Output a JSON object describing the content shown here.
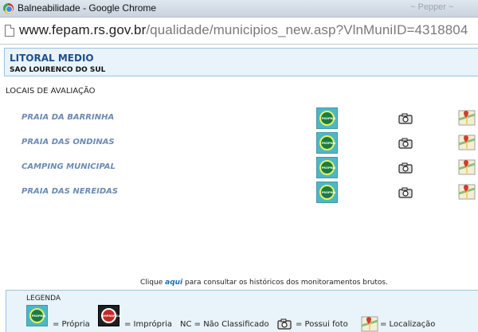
{
  "window": {
    "title": "Balneabilidade - Google Chrome",
    "faded_text": "~ Pepper ~"
  },
  "addressbar": {
    "host": "www.fepam.rs.gov.br",
    "path": "/qualidade/municipios_new.asp?VlnMuniID=4318804"
  },
  "header": {
    "region": "LITORAL MEDIO",
    "city": "SAO LOURENCO DO SUL"
  },
  "section_title": "LOCAIS DE AVALIAÇÃO",
  "badge_labels": {
    "propria": "PRÓPRIA",
    "impropria": "IMPRÓPRIA"
  },
  "beaches": [
    {
      "name": "PRAIA DA BARRINHA",
      "status": "propria"
    },
    {
      "name": "PRAIA DAS ONDINAS",
      "status": "propria"
    },
    {
      "name": "CAMPING MUNICIPAL",
      "status": "propria"
    },
    {
      "name": "PRAIA DAS NEREIDAS",
      "status": "propria"
    }
  ],
  "footnote": {
    "prefix": "Clique",
    "link": "aqui",
    "suffix": "para consultar os históricos dos monitoramentos brutos."
  },
  "legend": {
    "title": "LEGENDA",
    "propria": "= Própria",
    "impropria": "= Imprópria",
    "nc": "NC = Não Classificado",
    "photo": "= Possui foto",
    "location": "= Localização"
  },
  "colors": {
    "header_bg": "#e8f3fa",
    "header_border": "#9cc3de",
    "region_text": "#1f4e8c",
    "beach_link": "#6b8ab4",
    "badge_bg": "#4db7c7",
    "badge_green": "#1b7b45",
    "impropria_red": "#c62828"
  }
}
